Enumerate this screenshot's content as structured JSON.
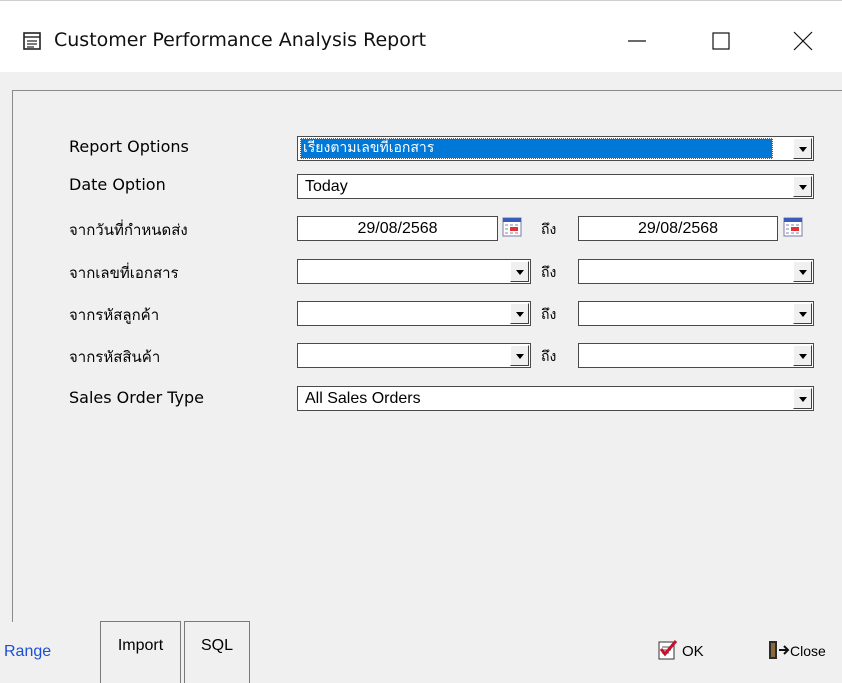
{
  "window": {
    "title": "Customer Performance Analysis Report",
    "icon": "report-icon",
    "controls": [
      "minimize-icon",
      "maximize-icon",
      "close-icon"
    ]
  },
  "form": {
    "report_options": {
      "label": "Report Options",
      "value": "เรียงตามเลขที่เอกสาร"
    },
    "date_option": {
      "label": "Date Option",
      "value": "Today"
    },
    "delivery_date": {
      "label": "จากวันที่กำหนดส่ง",
      "from": "29/08/2568",
      "to_label": "ถึง",
      "to": "29/08/2568"
    },
    "doc_no": {
      "label": "จากเลขที่เอกสาร",
      "from": "",
      "to_label": "ถึง",
      "to": ""
    },
    "customer_code": {
      "label": "จากรหัสลูกค้า",
      "from": "",
      "to_label": "ถึง",
      "to": ""
    },
    "product_code": {
      "label": "จากรหัสสินค้า",
      "from": "",
      "to_label": "ถึง",
      "to": ""
    },
    "sales_order_type": {
      "label": "Sales Order Type",
      "value": "All Sales Orders"
    }
  },
  "tabs": [
    {
      "label": "Range",
      "active": true
    },
    {
      "label": "Import"
    },
    {
      "label": "SQL"
    }
  ],
  "buttons": {
    "ok": "OK",
    "close": "Close"
  },
  "colors": {
    "selection": "#0078d7",
    "active_tab_text": "#1b4fd6",
    "background": "#f0f0f0"
  }
}
